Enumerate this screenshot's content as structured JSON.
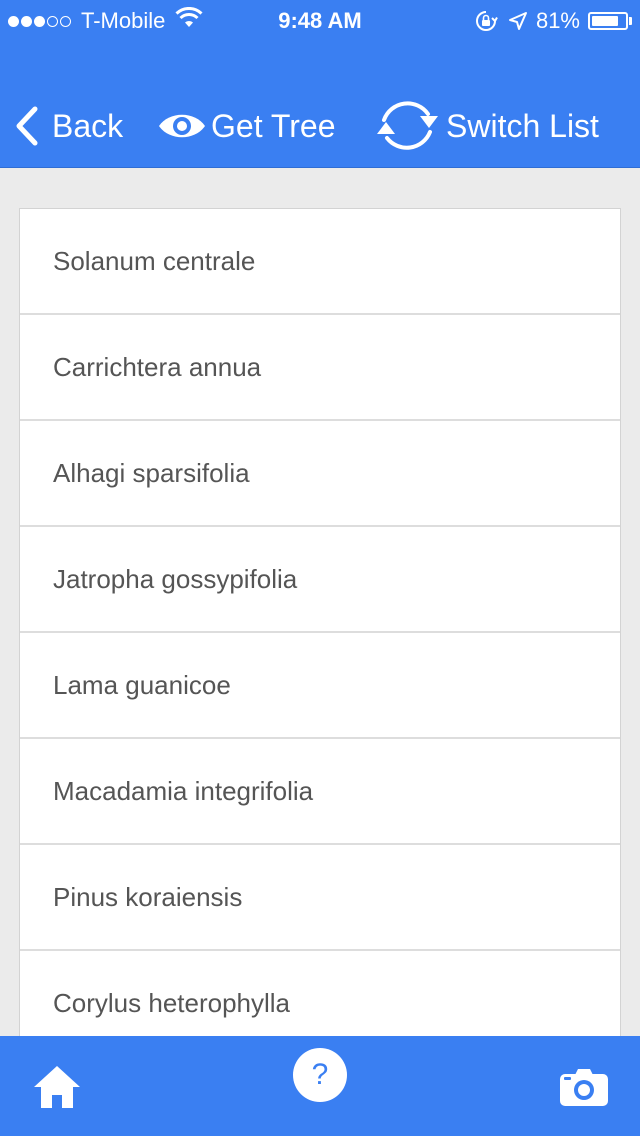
{
  "status_bar": {
    "signal_filled": 3,
    "signal_total": 5,
    "carrier": "T-Mobile",
    "time": "9:48 AM",
    "battery_percent": "81%",
    "battery_level": 0.81,
    "icons": [
      "wifi-icon",
      "orientation-lock-icon",
      "location-arrow-icon",
      "battery-icon"
    ]
  },
  "header": {
    "back_label": "Back",
    "get_tree_label": "Get Tree",
    "switch_list_label": "Switch List",
    "icons": {
      "back": "chevron-left-icon",
      "get_tree": "eye-icon",
      "switch_list": "refresh-cycle-icon"
    }
  },
  "list": {
    "items": [
      "Solanum centrale",
      "Carrichtera annua",
      "Alhagi sparsifolia",
      "Jatropha gossypifolia",
      "Lama guanicoe",
      "Macadamia integrifolia",
      "Pinus koraiensis",
      "Corylus heterophylla"
    ]
  },
  "tabbar": {
    "home_icon": "home-icon",
    "help_label": "?",
    "camera_icon": "camera-icon"
  },
  "colors": {
    "primary": "#3a7ff2",
    "background": "#ebebeb",
    "list_text": "#555555",
    "divider": "#dddddd"
  }
}
